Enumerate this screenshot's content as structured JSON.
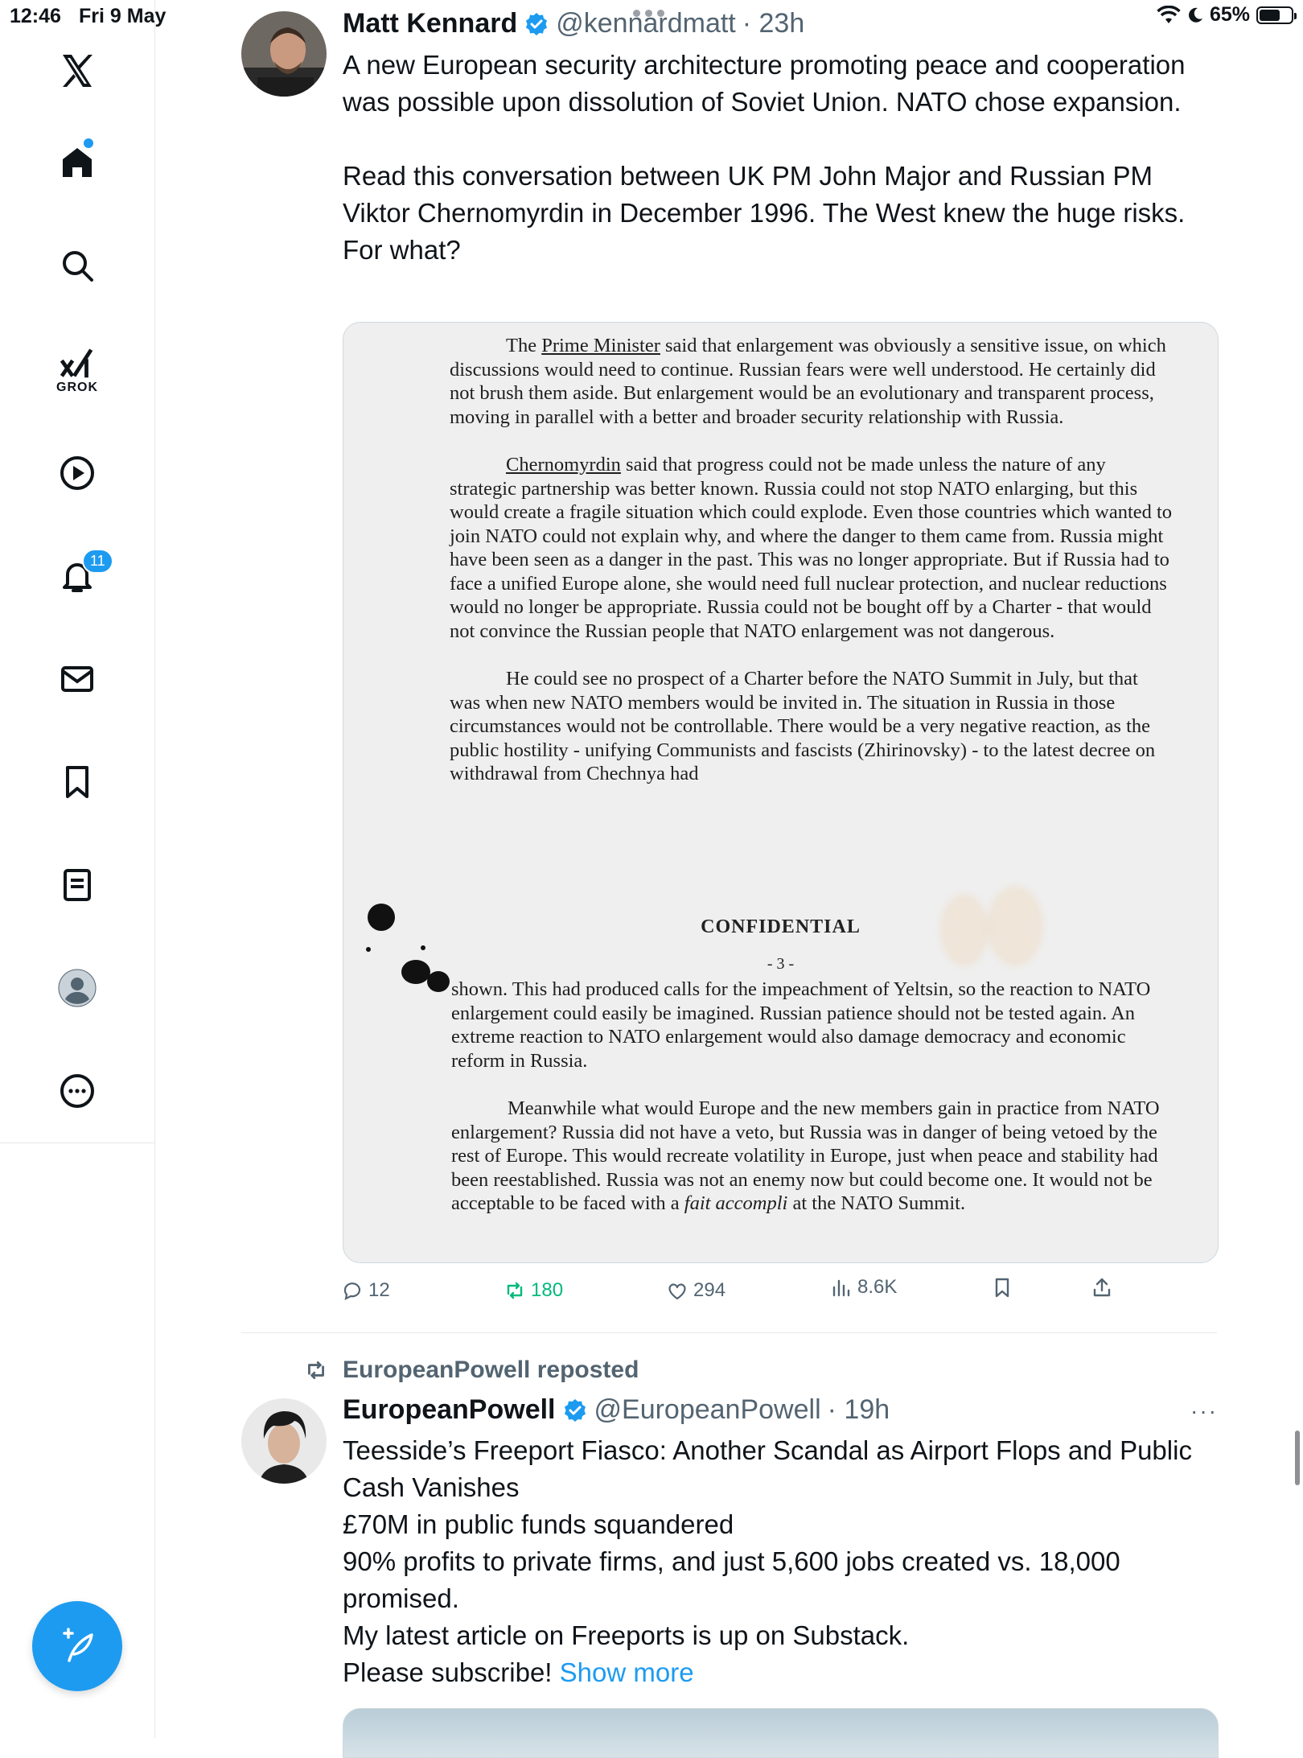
{
  "status_bar": {
    "time": "12:46",
    "date": "Fri 9 May",
    "battery": "65%",
    "battery_level": 0.65
  },
  "sidebar": {
    "grok_label": "GROK",
    "notifications_badge": "11"
  },
  "tweet1": {
    "name": "Matt Kennard",
    "handle": "@kennardmatt",
    "time": "· 23h",
    "text_p1": "A new European security architecture promoting peace and cooperation was possible upon dissolution of Soviet Union. NATO chose expansion.",
    "text_p2": "Read this conversation between UK PM John Major and Russian PM Viktor Chernomyrdin in December 1996. The West knew the huge risks. For what?",
    "document": {
      "para1_lead": "The ",
      "para1_subject": "Prime Minister",
      "para1_rest": " said that enlargement was obviously a sensitive issue, on which discussions would need to continue.  Russian fears were well understood.  He certainly did not brush them aside.  But enlargement would be an evolutionary and transparent process, moving in parallel with a better and broader security relationship with Russia.",
      "para2_subject": "Chernomyrdin",
      "para2_rest": " said that progress could not be made unless the nature of any strategic partnership was better known.  Russia could not stop NATO enlarging, but this would create a fragile situation which could explode.  Even those countries which wanted to join NATO could not explain why, and where the danger to them came from.  Russia might have been seen as a danger in the past.  This was no longer appropriate.  But if Russia had to face a unified Europe alone, she would need full nuclear protection, and nuclear reductions would no longer be appropriate.  Russia could not be bought off by a Charter - that would not convince the Russian people that NATO enlargement was not dangerous.",
      "para3": "He could see no prospect of a Charter before the NATO Summit in July, but that was when new NATO members would be invited in.  The situation in Russia in those circumstances would not be controllable.  There would be a very negative reaction, as the public hostility - unifying Communists and fascists (Zhirinovsky) - to the latest decree on withdrawal from Chechnya had",
      "confidential": "CONFIDENTIAL",
      "page_number": "- 3 -",
      "para4": "shown.  This had produced calls for the impeachment of Yeltsin, so the reaction to NATO enlargement could easily be imagined.  Russian patience should not be tested again.  An extreme reaction to NATO enlargement would also damage democracy and economic reform in Russia.",
      "para5_main": "Meanwhile what would Europe and the new members gain in practice from NATO enlargement?  Russia did not have a veto, but Russia was in danger of being vetoed by the rest of Europe.  This would recreate volatility in Europe, just when peace and stability had been reestablished.  Russia was not an enemy now but could become one.  It would not be acceptable to be faced with a ",
      "para5_italic": "fait accompli",
      "para5_tail": " at the NATO Summit."
    },
    "stats": {
      "replies": "12",
      "reposts": "180",
      "likes": "294",
      "views": "8.6K"
    }
  },
  "tweet2": {
    "repost_label": "EuropeanPowell reposted",
    "name": "EuropeanPowell",
    "handle": "@EuropeanPowell",
    "time": "· 19h",
    "more": "···",
    "lines": [
      "Teesside’s Freeport Fiasco: Another Scandal as Airport Flops and Public Cash Vanishes",
      "£70M in public funds squandered",
      "90% profits to private firms, and just 5,600 jobs created vs. 18,000 promised.",
      "My latest article on Freeports is up on Substack.",
      "Please subscribe! "
    ],
    "show_more": "Show more"
  },
  "colors": {
    "accent": "#1d9bf0",
    "repost_green": "#00ba7c",
    "muted": "#536471"
  }
}
